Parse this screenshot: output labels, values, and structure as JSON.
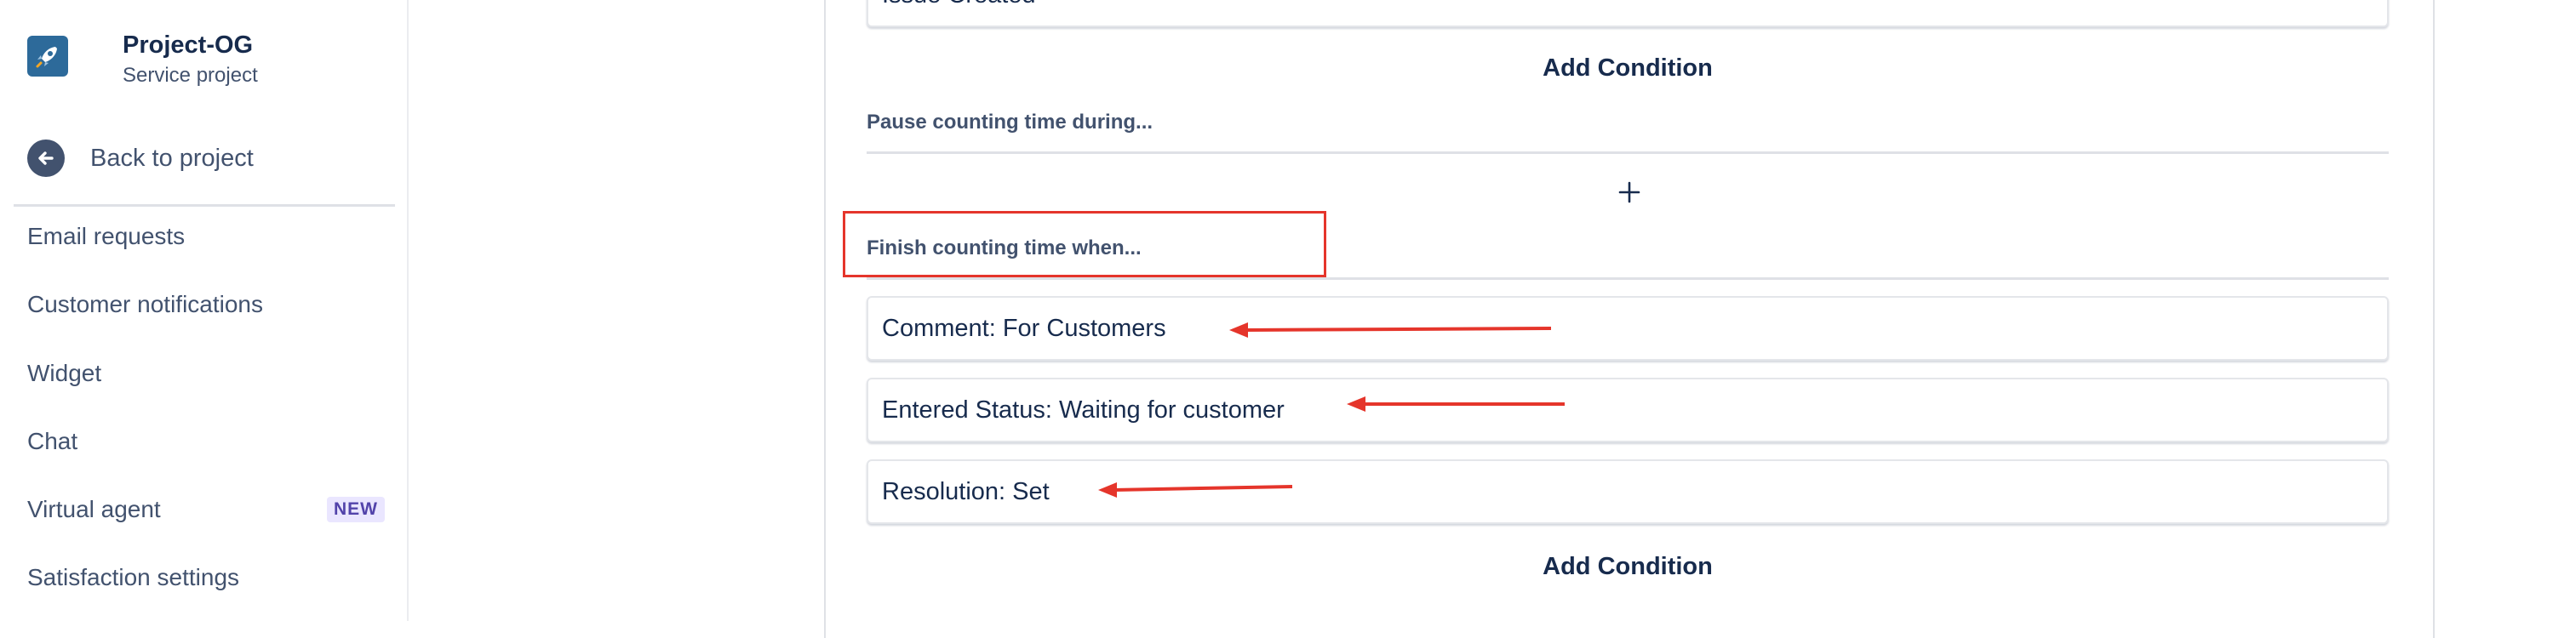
{
  "sidebar": {
    "project_name": "Project-OG",
    "project_type": "Service project",
    "back_label": "Back to project",
    "items": [
      {
        "label": "Email requests",
        "badge": ""
      },
      {
        "label": "Customer notifications",
        "badge": ""
      },
      {
        "label": "Widget",
        "badge": ""
      },
      {
        "label": "Chat",
        "badge": ""
      },
      {
        "label": "Virtual agent",
        "badge": "NEW"
      },
      {
        "label": "Satisfaction settings",
        "badge": ""
      }
    ]
  },
  "main": {
    "top_condition": "Issue Created",
    "add_condition_label": "Add Condition",
    "pause_label": "Pause counting time during...",
    "finish_label": "Finish counting time when...",
    "finish_conditions": [
      "Comment: For Customers",
      "Entered Status: Waiting for customer",
      "Resolution: Set"
    ]
  },
  "annotations": {
    "color": "#E5352B"
  }
}
